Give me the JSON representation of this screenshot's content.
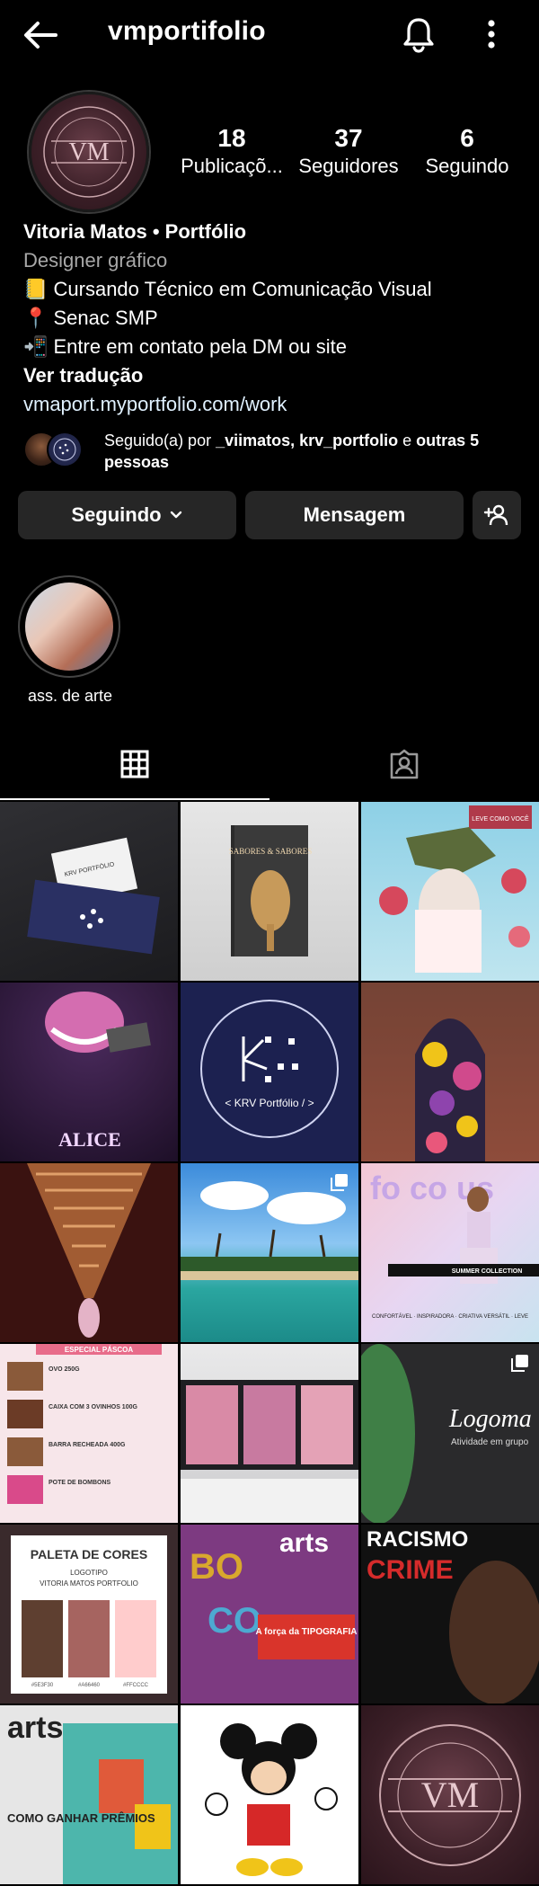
{
  "header": {
    "username": "vmportifolio",
    "back_icon": "arrow-left-icon",
    "bell_icon": "bell-icon",
    "more_icon": "more-vertical-icon"
  },
  "profile": {
    "avatar_initials": "VM",
    "avatar_ring_text": "VITORIA MATOS PORTFOLIO",
    "stats": [
      {
        "value": "18",
        "label": "Publicaçõ..."
      },
      {
        "value": "37",
        "label": "Seguidores"
      },
      {
        "value": "6",
        "label": "Seguindo"
      }
    ]
  },
  "bio": {
    "name": "Vitoria Matos • Portfólio",
    "category": "Designer gráfico",
    "lines": [
      "📒 Cursando Técnico em Comunicação Visual",
      "📍 Senac SMP",
      "📲 Entre em contato pela DM ou site"
    ],
    "translate": "Ver tradução",
    "link": "vmaport.myportfolio.com/work"
  },
  "followed_by": {
    "prefix": "Seguido(a) por ",
    "names": "_viimatos, krv_portfolio",
    "middle": " e ",
    "others": "outras 5 pessoas"
  },
  "buttons": {
    "following": "Seguindo",
    "message": "Mensagem",
    "add_person_icon": "add-person-icon"
  },
  "highlights": [
    {
      "label": "ass. de arte"
    }
  ],
  "tabs": [
    {
      "icon": "grid-icon",
      "active": true
    },
    {
      "icon": "tagged-icon",
      "active": false
    }
  ],
  "posts": [
    {
      "text": "KRV PORTFÓLIO"
    },
    {
      "text": "SABORES & SABORES"
    },
    {
      "text": "LEVE COMO VOCÊ"
    },
    {
      "text": "ALICE"
    },
    {
      "text": "< KRV Portfólio / >"
    },
    {
      "text": ""
    },
    {
      "text": ""
    },
    {
      "text": ""
    },
    {
      "text": "SUMMER COLLECTION"
    },
    {
      "text": "ESPECIAL PÁSCOA"
    },
    {
      "text": ""
    },
    {
      "text": "Logoma"
    },
    {
      "text": "PALETA DE CORES"
    },
    {
      "text": "arts"
    },
    {
      "text": "RACISMO É CRIME"
    },
    {
      "text": "arts"
    },
    {
      "text": ""
    },
    {
      "text": "VM"
    }
  ],
  "post_extra": {
    "fo_co": "fo co us",
    "focus_tags": "CONFORTÁVEL · INSPIRADORA · CRIATIVA VERSÁTIL · LEVE",
    "logoma_sub": "Atividade em grupo",
    "paleta_sub1": "LOGOTIPO",
    "paleta_sub2": "VITORIA MATOS PORTFOLIO",
    "paleta_hex": [
      "#5E3F30",
      "#A66460",
      "#FFCCCC"
    ],
    "arts_tipo": "A força da TIPOGRAFIA",
    "arts_premios": "COMO GANHAR PRÊMIOS",
    "pascoa_items": [
      "OVO 250G",
      "CAIXA COM 3 OVINHOS 100G",
      "BARRA RECHEADA 400G",
      "POTE DE BOMBONS"
    ]
  }
}
